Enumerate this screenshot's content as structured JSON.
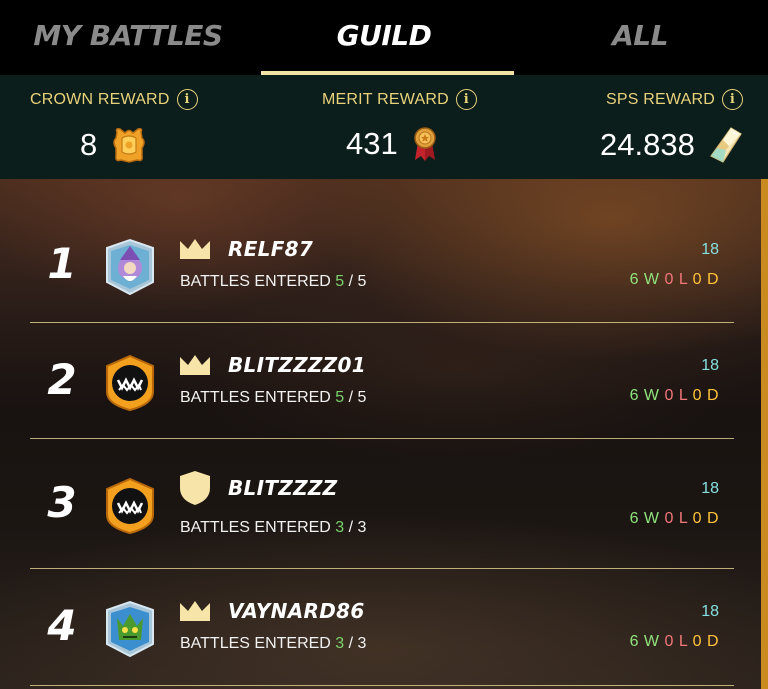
{
  "tabs": [
    {
      "label": "MY BATTLES",
      "active": false
    },
    {
      "label": "GUILD",
      "active": true
    },
    {
      "label": "ALL",
      "active": false
    }
  ],
  "rewards": {
    "crown": {
      "label": "CROWN REWARD",
      "value": "8",
      "icon": "crown-token-icon"
    },
    "merit": {
      "label": "MERIT REWARD",
      "value": "431",
      "icon": "merit-medal-icon"
    },
    "sps": {
      "label": "SPS REWARD",
      "value": "24.838",
      "icon": "sps-crystal-icon"
    },
    "info_glyph": "i"
  },
  "battles_label": "BATTLES ENTERED",
  "players": [
    {
      "rank": "1",
      "name": "RELF87",
      "role": "crown",
      "avatar": "wizard-avatar",
      "entered": "5",
      "total": "5",
      "score": "18",
      "w": "6 W",
      "l": "0 L",
      "d": "0 D"
    },
    {
      "rank": "2",
      "name": "BLITZZZZ01",
      "role": "crown",
      "avatar": "monster-badge",
      "entered": "5",
      "total": "5",
      "score": "18",
      "w": "6 W",
      "l": "0 L",
      "d": "0 D"
    },
    {
      "rank": "3",
      "name": "BLITZZZZ",
      "role": "shield",
      "avatar": "monster-badge",
      "entered": "3",
      "total": "3",
      "score": "18",
      "w": "6 W",
      "l": "0 L",
      "d": "0 D"
    },
    {
      "rank": "4",
      "name": "VAYNARD86",
      "role": "crown",
      "avatar": "goblin-avatar",
      "entered": "3",
      "total": "3",
      "score": "18",
      "w": "6 W",
      "l": "0 L",
      "d": "0 D"
    }
  ],
  "colors": {
    "accent": "#f2e3a5",
    "reward_label": "#e9d27a",
    "wins": "#8fe37d",
    "losses": "#f3777a",
    "draws": "#ffc23a",
    "score": "#86e0e0"
  }
}
